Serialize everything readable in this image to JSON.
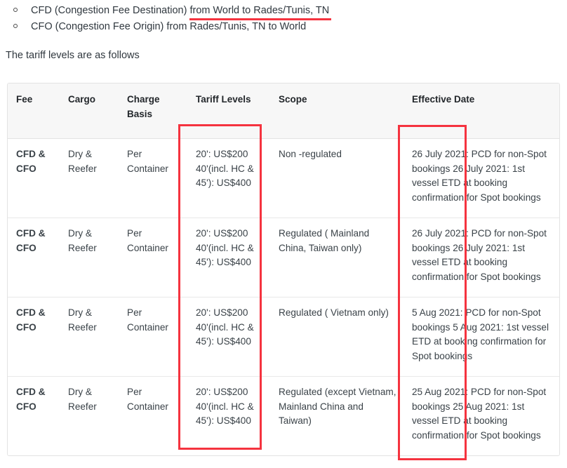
{
  "bullets": [
    {
      "prefix": "CFD (Congestion Fee Destination) ",
      "highlight": "from World to Rades/Tunis, TN",
      "suffix": "",
      "underlined": true
    },
    {
      "prefix": "CFO (Congestion Fee Origin) from Rades/Tunis, TN to World",
      "highlight": "",
      "suffix": "",
      "underlined": false
    }
  ],
  "intro": "The tariff levels are as follows",
  "table": {
    "headers": [
      "Fee",
      "Cargo",
      "Charge Basis",
      "Tariff Levels",
      "Scope",
      "Effective Date"
    ],
    "rows": [
      {
        "fee": "CFD & CFO",
        "cargo": "Dry & Reefer",
        "charge_basis": "Per Container",
        "tariff_levels": "20': US$200 40'(incl. HC & 45'): US$400",
        "scope": "Non -regulated",
        "effective_date": "26 July 2021: PCD for non-Spot bookings 26 July 2021: 1st vessel ETD at booking confirmation for Spot bookings"
      },
      {
        "fee": "CFD & CFO",
        "cargo": "Dry & Reefer",
        "charge_basis": "Per Container",
        "tariff_levels": "20': US$200 40'(incl. HC & 45'): US$400",
        "scope": "Regulated ( Mainland China, Taiwan only)",
        "effective_date": "26 July 2021: PCD for non-Spot bookings 26 July 2021: 1st vessel ETD at booking confirmation for Spot bookings"
      },
      {
        "fee": "CFD & CFO",
        "cargo": "Dry & Reefer",
        "charge_basis": "Per Container",
        "tariff_levels": "20': US$200 40'(incl. HC & 45'): US$400",
        "scope": "Regulated ( Vietnam only)",
        "effective_date": "5 Aug 2021: PCD for non-Spot bookings 5 Aug 2021: 1st vessel ETD at booking confirmation for Spot bookings"
      },
      {
        "fee": "CFD & CFO",
        "cargo": "Dry & Reefer",
        "charge_basis": "Per Container",
        "tariff_levels": "20': US$200 40'(incl. HC & 45'): US$400",
        "scope": "Regulated (except Vietnam, Mainland China and Taiwan)",
        "effective_date": "25 Aug 2021: PCD for non-Spot bookings 25 Aug 2021: 1st vessel ETD at booking confirmation for Spot bookings"
      }
    ]
  },
  "annotations": {
    "color": "#f5333f",
    "boxes": [
      {
        "name": "tariff-levels-column-highlight"
      },
      {
        "name": "effective-date-column-highlight"
      }
    ],
    "underline": {
      "name": "route-underline"
    }
  }
}
